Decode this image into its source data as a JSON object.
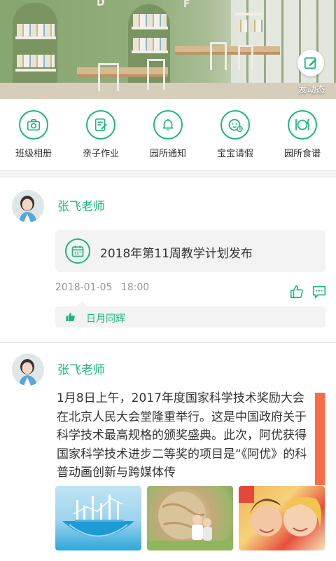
{
  "banner": {
    "post_label": "发动态",
    "letters": [
      "D",
      "F"
    ]
  },
  "menu": [
    {
      "label": "班级相册",
      "icon": "camera-icon"
    },
    {
      "label": "亲子作业",
      "icon": "homework-icon"
    },
    {
      "label": "园所通知",
      "icon": "bell-icon"
    },
    {
      "label": "宝宝请假",
      "icon": "baby-leave-icon"
    },
    {
      "label": "园所食谱",
      "icon": "plate-icon"
    }
  ],
  "feed": [
    {
      "author": "张飞老师",
      "card_text": "2018年第11周教学计划发布",
      "date": "2018-01-05",
      "time": "18:00",
      "liked_by": "日月同辉"
    },
    {
      "author": "张飞老师",
      "text": "1月8日上午，2017年度国家科学技术奖励大会在北京人民大会堂隆重举行。这是中国政府关于科学技术最高规格的颁奖盛典。此次，阿优获得国家科学技术进步二等奖的项目是“《阿优》的科普动画创新与跨媒体传"
    }
  ],
  "colors": {
    "accent": "#20b681",
    "scroll_indicator": "#fb6b46",
    "meta_text": "#999999"
  }
}
